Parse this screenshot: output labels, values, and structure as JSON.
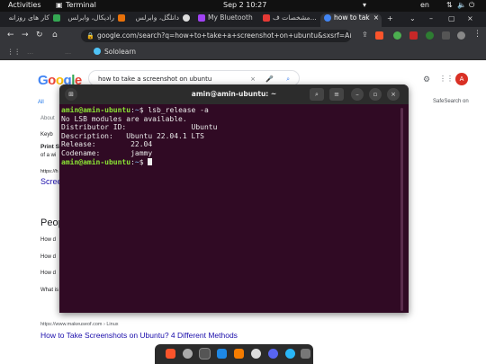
{
  "topbar": {
    "activities": "Activities",
    "app_name": "Terminal",
    "clock": "Sep 2  10:27",
    "keyboard_layout": "en"
  },
  "tabs": [
    {
      "label": "كار های روزانه",
      "color": "#34a853"
    },
    {
      "label": "راديكال، وابرلس",
      "color": "#e8710a"
    },
    {
      "label": "دانلگل، وابرلس",
      "color": "#dddddd"
    },
    {
      "label": "My Bluetooth",
      "color": "#a142f4"
    },
    {
      "label": "مشخصات ف...",
      "color": "#e53935"
    },
    {
      "label": "how to tak",
      "color": "#4285f4"
    }
  ],
  "window_controls": {
    "minimize": "–",
    "maximize": "▢",
    "close": "×"
  },
  "omnibox": {
    "url": "google.com/search?q=how+to+take+a+screenshot+on+ubuntu&sxsrf=ALiCzsZIvb..."
  },
  "bookmarks": {
    "item1": "...",
    "item2": "...",
    "item3": "Sololearn"
  },
  "google": {
    "logo": [
      "G",
      "o",
      "o",
      "g",
      "l",
      "e"
    ],
    "logo_colors": [
      "#4285f4",
      "#ea4335",
      "#fbbc05",
      "#4285f4",
      "#34a853",
      "#ea4335"
    ],
    "query": "how to take a screenshot on ubuntu",
    "tab_all": "All",
    "about": "About",
    "safesearch": "SafeSearch on",
    "avatar_letter": "A",
    "snippet_keyb": "Keyb",
    "snippet_print": "Print S",
    "snippet_ofaw": "of a wi",
    "snippet_https": "https://h",
    "snippet_scree": "Screen",
    "people_also": "Peop",
    "q1": "How d",
    "q2": "How d",
    "q3": "How d",
    "q4": "What is",
    "result_url": "https://www.makeuseof.com › Linux",
    "result_title": "How to Take Screenshots on Ubuntu? 4 Different Methods"
  },
  "terminal": {
    "title": "amin@amin-ubuntu: ~",
    "prompt_user": "amin@amin-ubuntu",
    "prompt_path": "~",
    "command": "lsb_release -a",
    "out1": "No LSB modules are available.",
    "out2": "Distributor ID:\tUbuntu",
    "out3": "Description:\tUbuntu 22.04.1 LTS",
    "out4": "Release:\t22.04",
    "out5": "Codename:\tjammy"
  }
}
